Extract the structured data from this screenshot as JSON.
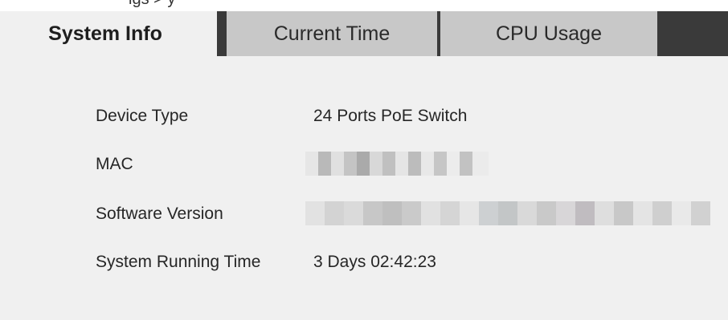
{
  "header": {
    "partial_text": "igs >    y"
  },
  "tabs": [
    {
      "label": "System Info",
      "active": true
    },
    {
      "label": "Current Time",
      "active": false
    },
    {
      "label": "CPU Usage",
      "active": false
    }
  ],
  "info": {
    "device_type_label": "Device Type",
    "device_type_value": "24 Ports PoE Switch",
    "mac_label": "MAC",
    "mac_value_redacted": true,
    "software_version_label": "Software Version",
    "software_version_redacted": true,
    "running_time_label": "System Running Time",
    "running_time_value": "3 Days 02:42:23"
  },
  "colors": {
    "panel_bg": "#f0f0f0",
    "inactive_tab_bg": "#c8c8c8",
    "tabbar_bg": "#3a3a3a",
    "text": "#262626"
  }
}
